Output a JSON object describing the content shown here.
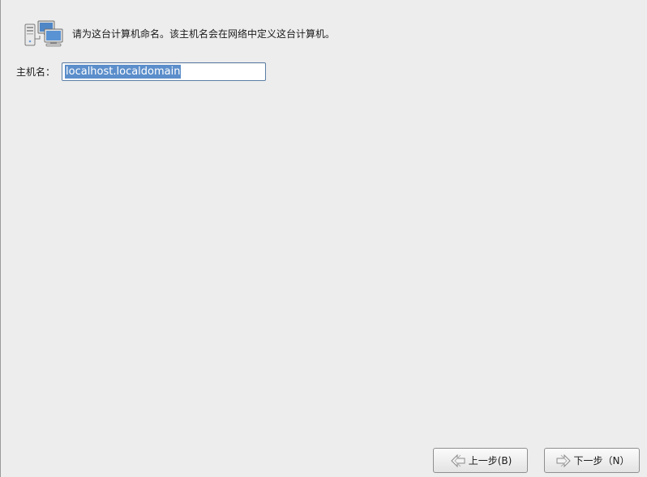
{
  "header": {
    "icon": "network-computers-icon",
    "description": "请为这台计算机命名。该主机名会在网络中定义这台计算机。"
  },
  "hostname": {
    "label": "主机名：",
    "value": "localhost.localdomain",
    "selected": true
  },
  "buttons": {
    "back": {
      "label": "上一步(B)",
      "icon": "back-arrow-icon"
    },
    "next": {
      "label": "下一步（N）",
      "icon": "next-arrow-icon"
    }
  },
  "colors": {
    "background": "#ededed",
    "selection": "#5b8ecb",
    "field_border": "#5a7ea6"
  }
}
